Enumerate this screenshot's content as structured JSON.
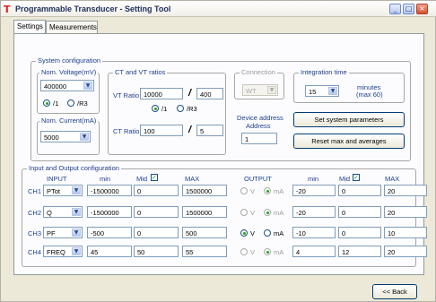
{
  "window": {
    "title": "Programmable Transducer - Setting Tool"
  },
  "tabs": [
    "Settings",
    "Measurements"
  ],
  "system": {
    "group_title": "System configuration",
    "nom_voltage": {
      "label": "Nom. Voltage(mV)",
      "value": "400000",
      "r1": "/1",
      "r2": "/R3"
    },
    "nom_current": {
      "label": "Nom. Current(mA)",
      "value": "5000"
    }
  },
  "ct_vt": {
    "group_title": "CT and VT ratios",
    "vt": {
      "label": "VT Ratio",
      "num": "10000",
      "den": "400",
      "r1": "/1",
      "r2": "/R3"
    },
    "ct": {
      "label": "CT Ratio",
      "num": "100",
      "den": "5"
    }
  },
  "connection": {
    "group_title": "Connection",
    "value": "WT"
  },
  "device_address": {
    "label1": "Device address",
    "label2": "Address",
    "value": "1"
  },
  "integration": {
    "group_title": "Integration time",
    "value": "15",
    "unit1": "minutes",
    "unit2": "(max 60)"
  },
  "buttons": {
    "set_params": "Set system parameters",
    "reset": "Reset max and averages",
    "back": "<< Back"
  },
  "io": {
    "group_title": "Input and Output configuration",
    "headers": {
      "input": "INPUT",
      "min": "min",
      "mid": "Mid",
      "max": "MAX",
      "output": "OUTPUT",
      "out_min": "min",
      "out_mid": "Mid",
      "out_max": "MAX"
    },
    "v_label": "V",
    "ma_label": "mA",
    "rows": [
      {
        "ch": "CH1",
        "input": "PTot",
        "min": "-1500000",
        "mid": "0",
        "max": "1500000",
        "mode": "mA",
        "omin": "-20",
        "omid": "0",
        "omax": "20"
      },
      {
        "ch": "CH2",
        "input": "Q",
        "min": "-1500000",
        "mid": "0",
        "max": "1500000",
        "mode": "mA",
        "omin": "-20",
        "omid": "0",
        "omax": "20"
      },
      {
        "ch": "CH3",
        "input": "PF",
        "min": "-500",
        "mid": "0",
        "max": "500",
        "mode": "V",
        "omin": "-10",
        "omid": "0",
        "omax": "10"
      },
      {
        "ch": "CH4",
        "input": "FREQ",
        "min": "45",
        "mid": "50",
        "max": "55",
        "mode": "mA",
        "omin": "4",
        "omid": "12",
        "omax": "20"
      }
    ]
  }
}
